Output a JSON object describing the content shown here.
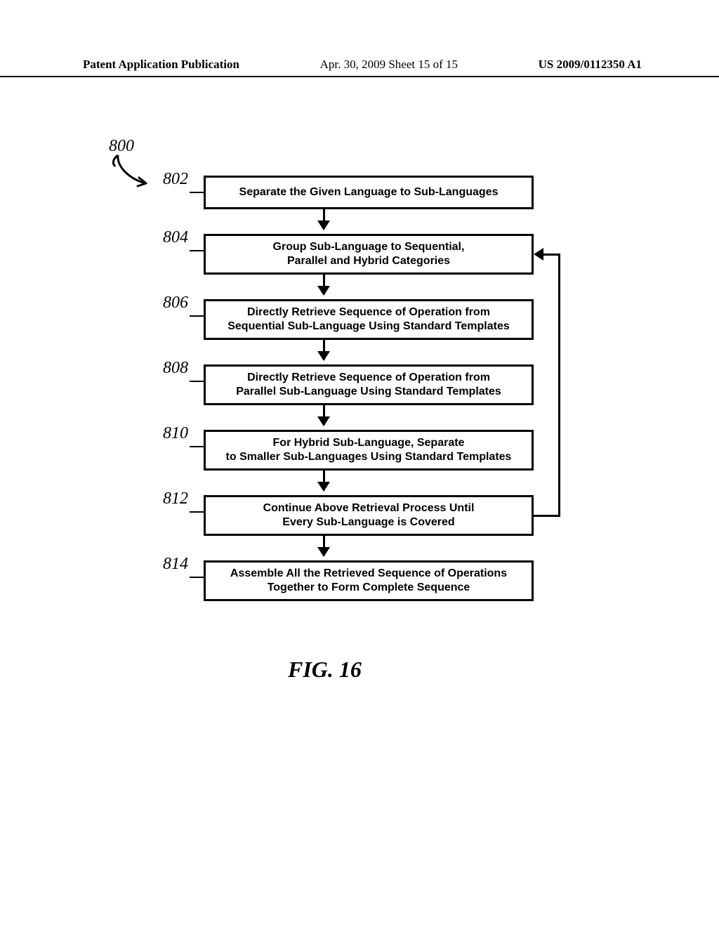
{
  "header": {
    "left": "Patent Application Publication",
    "mid": "Apr. 30, 2009  Sheet 15 of 15",
    "right": "US 2009/0112350 A1"
  },
  "diagram": {
    "ref_main": "800",
    "steps": [
      {
        "ref": "802",
        "text": "Separate the Given Language to Sub-Languages"
      },
      {
        "ref": "804",
        "text": "Group Sub-Language to Sequential,\nParallel and Hybrid Categories"
      },
      {
        "ref": "806",
        "text": "Directly Retrieve Sequence of Operation from\nSequential Sub-Language Using Standard Templates"
      },
      {
        "ref": "808",
        "text": "Directly Retrieve Sequence of Operation from\nParallel Sub-Language Using Standard Templates"
      },
      {
        "ref": "810",
        "text": "For Hybrid Sub-Language, Separate\nto Smaller Sub-Languages Using Standard Templates"
      },
      {
        "ref": "812",
        "text": "Continue Above Retrieval Process Until\nEvery Sub-Language is Covered"
      },
      {
        "ref": "814",
        "text": "Assemble All the Retrieved Sequence of Operations\nTogether to Form Complete Sequence"
      }
    ],
    "figure_caption": "FIG.  16"
  }
}
